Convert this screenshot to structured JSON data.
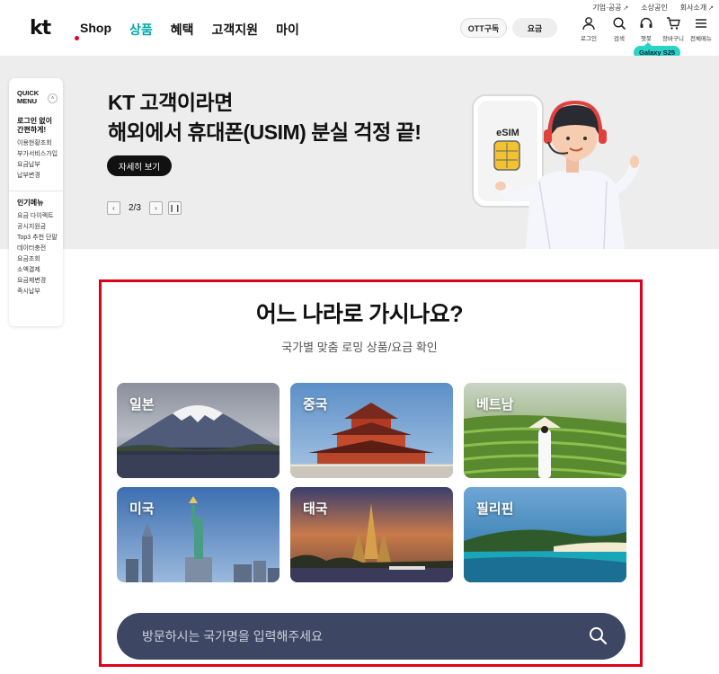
{
  "utility": {
    "links": [
      "기업·공공",
      "소상공인",
      "회사소개"
    ]
  },
  "logo": {
    "text": "kt"
  },
  "nav": {
    "items": [
      "Shop",
      "상품",
      "혜택",
      "고객지원",
      "마이"
    ],
    "active_index": 1
  },
  "header_buttons": {
    "ott": "OTT구독",
    "rate": "요금"
  },
  "header_icons": [
    {
      "icon": "user-icon",
      "label": "로그인"
    },
    {
      "icon": "search-icon",
      "label": "검색"
    },
    {
      "icon": "headset-icon",
      "label": "챗봇"
    },
    {
      "icon": "cart-icon",
      "label": "장바구니"
    },
    {
      "icon": "menu-icon",
      "label": "전체메뉴"
    }
  ],
  "promo_badge": "Galaxy S25",
  "banner": {
    "title_line1": "KT 고객이라면",
    "title_line2": "해외에서 휴대폰(USIM) 분실 걱정 끝!",
    "cta": "자세히 보기",
    "counter": "2/3",
    "esim_label": "eSIM"
  },
  "quick_menu": {
    "title_line1": "QUICK",
    "title_line2": "MENU",
    "login_heading_line1": "로그인 없이",
    "login_heading_line2": "간편하게!",
    "login_items": [
      "이용현황조회",
      "부가서비스가입",
      "요금납부",
      "납부변경"
    ],
    "popular_heading": "인기메뉴",
    "popular_items": [
      "요금 다이렉트",
      "공시지원금",
      "Top3 추천 단말",
      "데이터충전",
      "요금조회",
      "소액결제",
      "요금제변경",
      "즉시납부"
    ]
  },
  "roaming": {
    "title": "어느 나라로 가시나요?",
    "subtitle": "국가별 맞춤 로밍 상품/요금 확인",
    "countries": [
      "일본",
      "중국",
      "베트남",
      "미국",
      "태국",
      "필리핀"
    ],
    "search_placeholder": "방문하시는 국가명을 입력해주세요"
  },
  "colors": {
    "accent": "#00a9a5",
    "highlight_border": "#e0001b",
    "search_bg": "#3d4763",
    "badge": "#29d3c6"
  }
}
